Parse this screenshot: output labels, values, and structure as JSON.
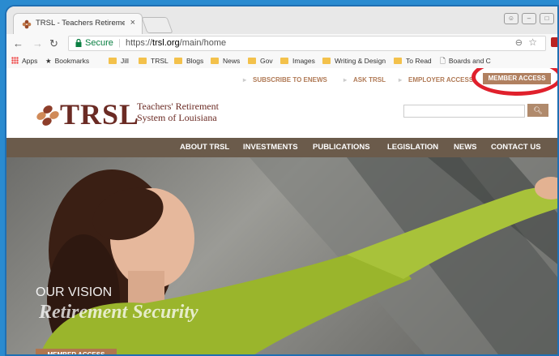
{
  "browser": {
    "tab_title": "TRSL - Teachers Retireme",
    "tab_close": "×",
    "secure_label": "Secure",
    "url_scheme": "https://",
    "url_host": "trsl.org",
    "url_path": "/main/home"
  },
  "bookmarks": [
    {
      "label": "Apps",
      "type": "apps"
    },
    {
      "label": "Bookmarks",
      "type": "star"
    },
    {
      "label": "Jill",
      "type": "folder"
    },
    {
      "label": "TRSL",
      "type": "folder"
    },
    {
      "label": "Blogs",
      "type": "folder"
    },
    {
      "label": "News",
      "type": "folder"
    },
    {
      "label": "Gov",
      "type": "folder"
    },
    {
      "label": "Images",
      "type": "folder"
    },
    {
      "label": "Writing & Design",
      "type": "folder"
    },
    {
      "label": "To Read",
      "type": "folder"
    },
    {
      "label": "Boards and C",
      "type": "page"
    }
  ],
  "topnav": {
    "subscribe": "SUBSCRIBE TO ENEWS",
    "ask": "ASK TRSL",
    "employer": "EMPLOYER ACCESS",
    "member": "MEMBER ACCESS"
  },
  "logo": {
    "abbr": "TRSL",
    "line1": "Teachers' Retirement",
    "line2": "System of Louisiana"
  },
  "search": {
    "button_icon": "search-icon"
  },
  "mainnav": [
    "ABOUT TRSL",
    "INVESTMENTS",
    "PUBLICATIONS",
    "LEGISLATION",
    "NEWS",
    "CONTACT US"
  ],
  "hero": {
    "vision": "OUR VISION",
    "tagline": "Retirement Security",
    "member_button": "MEMBER ACCESS"
  },
  "colors": {
    "brand": "#6b2b24",
    "accent": "#b08060",
    "nav_bg": "#6b5b4b",
    "highlight_ring": "#e0202c"
  }
}
